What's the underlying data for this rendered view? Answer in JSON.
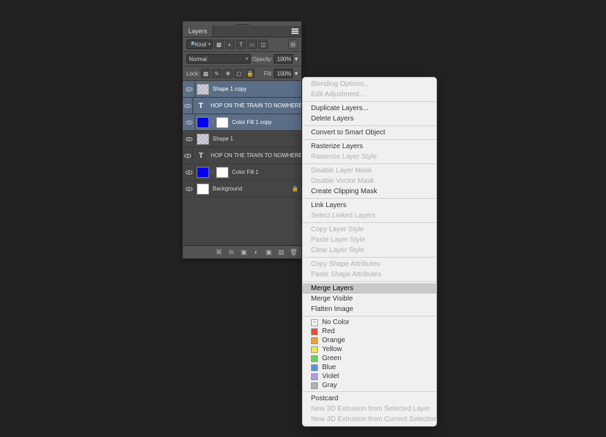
{
  "panel": {
    "title": "Layers",
    "filter": {
      "kind_label": "Kind",
      "icons": [
        "img",
        "adj",
        "type",
        "shape",
        "smart"
      ]
    },
    "blend": {
      "mode": "Normal",
      "opacity_label": "Opacity:",
      "opacity_value": "100%"
    },
    "lock": {
      "label": "Lock:",
      "fill_label": "Fill:",
      "fill_value": "100%"
    },
    "layers": [
      {
        "name": "Shape 1 copy",
        "kind": "shape-pattern",
        "selected": true,
        "mask": false
      },
      {
        "name": "HOP ON THE TRAIN TO NOWHERE BAB...",
        "kind": "type",
        "selected": true,
        "mask": false
      },
      {
        "name": "Color Fill 1 copy",
        "kind": "fill-blue",
        "selected": true,
        "mask": true
      },
      {
        "name": "Shape 1",
        "kind": "shape-pattern",
        "selected": false,
        "mask": false
      },
      {
        "name": "HOP ON THE TRAIN TO NOWHERE BABY",
        "kind": "type",
        "selected": false,
        "mask": false
      },
      {
        "name": "Color Fill 1",
        "kind": "fill-blue",
        "selected": false,
        "mask": true
      },
      {
        "name": "Background",
        "kind": "bg",
        "selected": false,
        "locked": true
      }
    ],
    "footer_icons": [
      "link",
      "fx",
      "mask",
      "adjust",
      "group",
      "new",
      "trash"
    ]
  },
  "menu": {
    "items": [
      {
        "label": "Blending Options...",
        "enabled": false
      },
      {
        "label": "Edit Adjustment...",
        "enabled": false
      },
      {
        "type": "sep"
      },
      {
        "label": "Duplicate Layers...",
        "enabled": true
      },
      {
        "label": "Delete Layers",
        "enabled": true
      },
      {
        "type": "sep"
      },
      {
        "label": "Convert to Smart Object",
        "enabled": true
      },
      {
        "type": "sep"
      },
      {
        "label": "Rasterize Layers",
        "enabled": true
      },
      {
        "label": "Rasterize Layer Style",
        "enabled": false
      },
      {
        "type": "sep"
      },
      {
        "label": "Disable Layer Mask",
        "enabled": false
      },
      {
        "label": "Disable Vector Mask",
        "enabled": false
      },
      {
        "label": "Create Clipping Mask",
        "enabled": true
      },
      {
        "type": "sep"
      },
      {
        "label": "Link Layers",
        "enabled": true
      },
      {
        "label": "Select Linked Layers",
        "enabled": false
      },
      {
        "type": "sep"
      },
      {
        "label": "Copy Layer Style",
        "enabled": false
      },
      {
        "label": "Paste Layer Style",
        "enabled": false
      },
      {
        "label": "Clear Layer Style",
        "enabled": false
      },
      {
        "type": "sep"
      },
      {
        "label": "Copy Shape Attributes",
        "enabled": false
      },
      {
        "label": "Paste Shape Attributes",
        "enabled": false
      },
      {
        "type": "sep"
      },
      {
        "label": "Merge Layers",
        "enabled": true,
        "highlight": true
      },
      {
        "label": "Merge Visible",
        "enabled": true
      },
      {
        "label": "Flatten Image",
        "enabled": true
      },
      {
        "type": "sep"
      },
      {
        "type": "color",
        "label": "No Color",
        "swatch": "none",
        "checked": true
      },
      {
        "type": "color",
        "label": "Red",
        "swatch": "red"
      },
      {
        "type": "color",
        "label": "Orange",
        "swatch": "orange"
      },
      {
        "type": "color",
        "label": "Yellow",
        "swatch": "yellow"
      },
      {
        "type": "color",
        "label": "Green",
        "swatch": "green"
      },
      {
        "type": "color",
        "label": "Blue",
        "swatch": "blue"
      },
      {
        "type": "color",
        "label": "Violet",
        "swatch": "violet"
      },
      {
        "type": "color",
        "label": "Gray",
        "swatch": "gray"
      },
      {
        "type": "sep"
      },
      {
        "label": "Postcard",
        "enabled": true
      },
      {
        "label": "New 3D Extrusion from Selected Layer",
        "enabled": false
      },
      {
        "label": "New 3D Extrusion from Current Selection",
        "enabled": false
      }
    ]
  }
}
